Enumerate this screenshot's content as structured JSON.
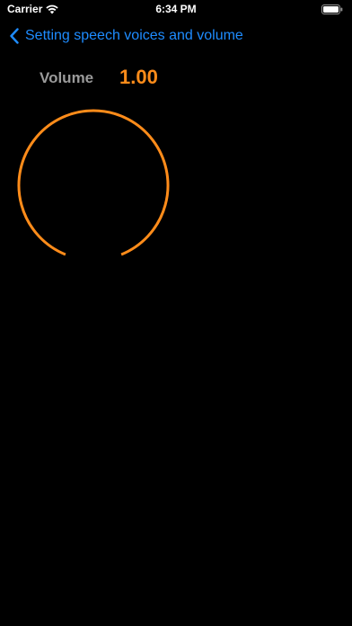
{
  "status": {
    "carrier": "Carrier",
    "time": "6:34 PM"
  },
  "nav": {
    "back_label": "Setting speech voices and volume"
  },
  "volume": {
    "label": "Volume",
    "value_text": "1.00",
    "level": 1.0
  },
  "colors": {
    "accent": "#ff8c1a",
    "link": "#1e8cff",
    "label": "#9a9a9a",
    "background": "#000000"
  },
  "icons": {
    "wifi": "wifi-icon",
    "battery": "battery-icon",
    "back": "chevron-left-icon"
  }
}
